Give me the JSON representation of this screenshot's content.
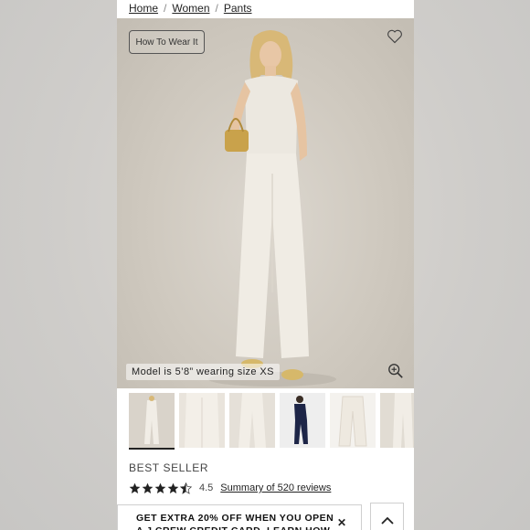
{
  "breadcrumb": {
    "items": [
      "Home",
      "Women",
      "Pants"
    ],
    "separator": "/"
  },
  "hero": {
    "how_to_wear_label": "How To Wear It",
    "model_caption": "Model is 5’8” wearing size XS",
    "icons": [
      "heart-icon",
      "zoom-in-icon"
    ]
  },
  "thumbnails": {
    "count": 6,
    "selected_index": 0
  },
  "product": {
    "badge": "BEST SELLER",
    "rating": "4.5",
    "rating_fraction": 0.9,
    "reviews_link": "Summary of 520 reviews"
  },
  "promo": {
    "text": "GET EXTRA 20% OFF WHEN YOU OPEN A J.CREW CREDIT CARD. LEARN HOW",
    "close_label": "✕"
  },
  "colors": {
    "accent": "#222222",
    "star": "#222222",
    "hero_bg": "#cfc9bf"
  }
}
